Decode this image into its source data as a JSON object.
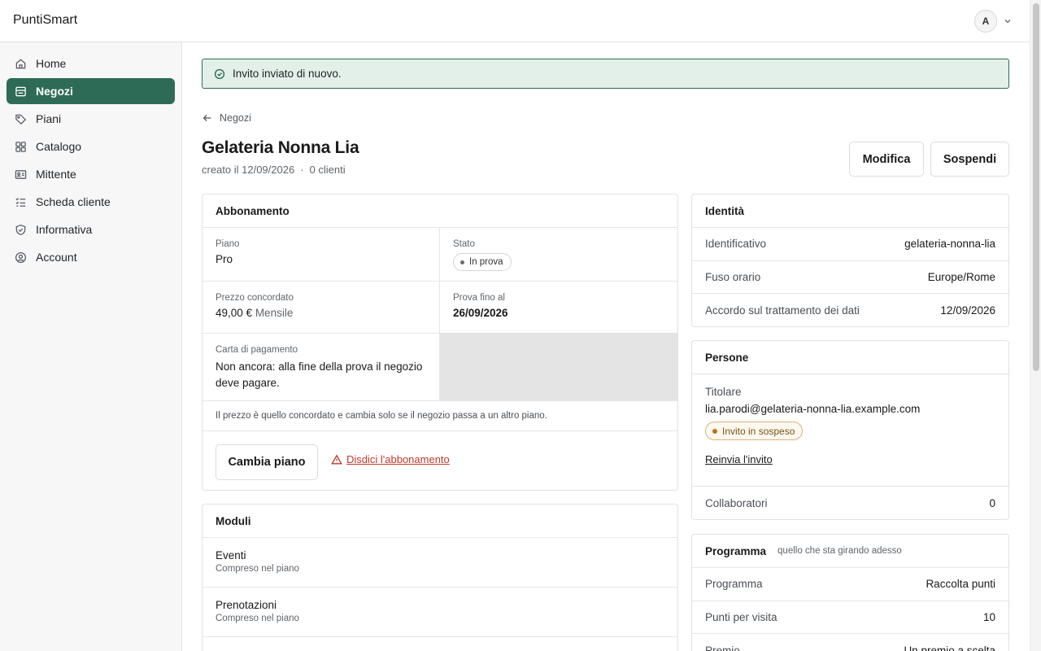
{
  "app": {
    "name": "PuntiSmart"
  },
  "user": {
    "initial": "A"
  },
  "sidebar": {
    "items": [
      {
        "label": "Home",
        "icon": "home-icon"
      },
      {
        "label": "Negozi",
        "icon": "store-icon",
        "active": true
      },
      {
        "label": "Piani",
        "icon": "tag-icon"
      },
      {
        "label": "Catalogo",
        "icon": "grid-icon"
      },
      {
        "label": "Mittente",
        "icon": "id-card-icon"
      },
      {
        "label": "Scheda cliente",
        "icon": "checklist-icon"
      },
      {
        "label": "Informativa",
        "icon": "shield-icon"
      },
      {
        "label": "Account",
        "icon": "user-circle-icon"
      }
    ]
  },
  "toast": {
    "message": "Invito inviato di nuovo."
  },
  "breadcrumb": {
    "back_label": "Negozi"
  },
  "header": {
    "title": "Gelateria Nonna Lia",
    "created": "creato il 12/09/2026",
    "separator": "·",
    "clients": "0 clienti",
    "edit_label": "Modifica",
    "suspend_label": "Sospendi"
  },
  "subscription": {
    "title": "Abbonamento",
    "plan_label": "Piano",
    "plan_value": "Pro",
    "status_label": "Stato",
    "status_value": "In prova",
    "price_label": "Prezzo concordato",
    "price_value": "49,00 €",
    "price_period": "Mensile",
    "trial_label": "Prova fino al",
    "trial_value": "26/09/2026",
    "card_label": "Carta di pagamento",
    "card_value": "Non ancora: alla fine della prova il negozio deve pagare.",
    "note": "Il prezzo è quello concordato e cambia solo se il negozio passa a un altro piano.",
    "change_plan_label": "Cambia piano",
    "cancel_label": "Disdici l'abbonamento"
  },
  "modules": {
    "title": "Moduli",
    "items": [
      {
        "name": "Eventi",
        "status": "Compreso nel piano"
      },
      {
        "name": "Prenotazioni",
        "status": "Compreso nel piano"
      }
    ]
  },
  "identity": {
    "title": "Identità",
    "rows": [
      {
        "key": "Identificativo",
        "value": "gelateria-nonna-lia"
      },
      {
        "key": "Fuso orario",
        "value": "Europe/Rome"
      },
      {
        "key": "Accordo sul trattamento dei dati",
        "value": "12/09/2026"
      }
    ]
  },
  "people": {
    "title": "Persone",
    "owner_label": "Titolare",
    "owner_email": "lia.parodi@gelateria-nonna-lia.example.com",
    "invite_status": "Invito in sospeso",
    "resend_label": "Reinvia l'invito",
    "collaborators_label": "Collaboratori",
    "collaborators_value": "0"
  },
  "program": {
    "title": "Programma",
    "hint": "quello che sta girando adesso",
    "rows": [
      {
        "key": "Programma",
        "value": "Raccolta punti"
      },
      {
        "key": "Punti per visita",
        "value": "10"
      },
      {
        "key": "Premio",
        "value": "Un premio a scelta"
      }
    ]
  },
  "colors": {
    "accent": "#2e6b57",
    "toast_bg": "#e3efe9",
    "danger": "#c0392b",
    "warning": "#b8731a"
  }
}
